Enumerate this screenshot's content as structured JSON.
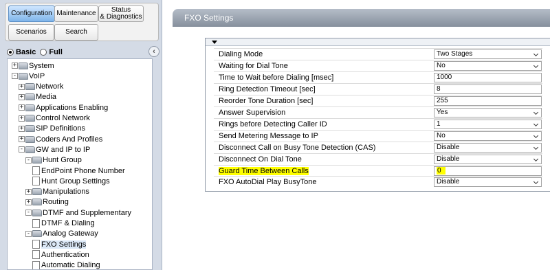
{
  "top_tabs": {
    "configuration": "Configuration",
    "maintenance": "Maintenance",
    "status_line1": "Status",
    "status_line2": "& Diagnostics",
    "scenarios": "Scenarios",
    "search": "Search"
  },
  "mode": {
    "basic": "Basic",
    "full": "Full",
    "selected": "Basic",
    "collapse_icon": "chevron-left-icon"
  },
  "tree": [
    {
      "label": "System",
      "expander": "+",
      "icon": "folder"
    },
    {
      "label": "VoIP",
      "expander": "-",
      "icon": "folder"
    },
    {
      "label": "Network",
      "expander": "+",
      "icon": "folder"
    },
    {
      "label": "Media",
      "expander": "+",
      "icon": "folder"
    },
    {
      "label": "Applications Enabling",
      "expander": "+",
      "icon": "folder"
    },
    {
      "label": "Control Network",
      "expander": "+",
      "icon": "folder"
    },
    {
      "label": "SIP Definitions",
      "expander": "+",
      "icon": "folder"
    },
    {
      "label": "Coders And Profiles",
      "expander": "+",
      "icon": "folder"
    },
    {
      "label": "GW and IP to IP",
      "expander": "-",
      "icon": "folder"
    },
    {
      "label": "Hunt Group",
      "expander": "-",
      "icon": "folder"
    },
    {
      "label": "EndPoint Phone Number",
      "expander": "",
      "icon": "page"
    },
    {
      "label": "Hunt Group Settings",
      "expander": "",
      "icon": "page"
    },
    {
      "label": "Manipulations",
      "expander": "+",
      "icon": "folder"
    },
    {
      "label": "Routing",
      "expander": "+",
      "icon": "folder"
    },
    {
      "label": "DTMF and Supplementary",
      "expander": "-",
      "icon": "folder"
    },
    {
      "label": "DTMF & Dialing",
      "expander": "",
      "icon": "page"
    },
    {
      "label": "Analog Gateway",
      "expander": "-",
      "icon": "folder"
    },
    {
      "label": "FXO Settings",
      "expander": "",
      "icon": "page",
      "selected": true
    },
    {
      "label": "Authentication",
      "expander": "",
      "icon": "page"
    },
    {
      "label": "Automatic Dialing",
      "expander": "",
      "icon": "page"
    }
  ],
  "panel": {
    "title": "FXO Settings",
    "rows": [
      {
        "label": "Dialing Mode",
        "value": "Two Stages",
        "type": "select"
      },
      {
        "label": "Waiting for Dial Tone",
        "value": "No",
        "type": "select"
      },
      {
        "label": "Time to Wait before Dialing [msec]",
        "value": "1000",
        "type": "text"
      },
      {
        "label": "Ring Detection Timeout [sec]",
        "value": "8",
        "type": "text"
      },
      {
        "label": "Reorder Tone Duration [sec]",
        "value": "255",
        "type": "text"
      },
      {
        "label": "Answer Supervision",
        "value": "Yes",
        "type": "select"
      },
      {
        "label": "Rings before Detecting Caller ID",
        "value": "1",
        "type": "select"
      },
      {
        "label": "Send Metering Message to IP",
        "value": "No",
        "type": "select"
      },
      {
        "label": "Disconnect Call on Busy Tone Detection (CAS)",
        "value": "Disable",
        "type": "select"
      },
      {
        "label": "Disconnect On Dial Tone",
        "value": "Disable",
        "type": "select"
      },
      {
        "label": "Guard Time Between Calls",
        "value": "0",
        "type": "text",
        "highlight": true
      },
      {
        "label": "FXO AutoDial Play BusyTone",
        "value": "Disable",
        "type": "select"
      }
    ]
  },
  "colors": {
    "highlight": "#ffff00",
    "header": "#9aa3af",
    "active_tab": "#7fb5ea"
  }
}
